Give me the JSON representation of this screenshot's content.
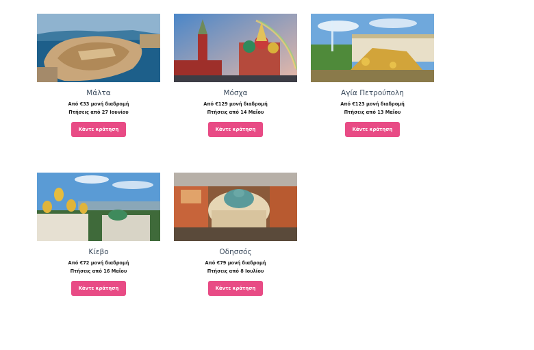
{
  "cards": [
    {
      "city": "Μάλτα",
      "price": "Από €33 μονή διαδρομή",
      "flights": "Πτήσεις από 27 Ιουνίου",
      "button": "Κάντε κράτηση",
      "image": "malta-aerial-photo"
    },
    {
      "city": "Μόσχα",
      "price": "Από €129 μονή διαδρομή",
      "flights": "Πτήσεις από 14 Μαΐου",
      "button": "Κάντε κράτηση",
      "image": "moscow-kremlin-photo"
    },
    {
      "city": "Αγία Πετρούπολη",
      "price": "Από €123 μονή διαδρομή",
      "flights": "Πτήσεις από 13 Μαΐου",
      "button": "Κάντε κράτηση",
      "image": "petersburg-peterhof-photo"
    },
    {
      "city": "Κίεβο",
      "price": "Από €72 μονή διαδρομή",
      "flights": "Πτήσεις από 16 Μαΐου",
      "button": "Κάντε κράτηση",
      "image": "kiev-lavra-photo"
    },
    {
      "city": "Οδησσός",
      "price": "Από €79 μονή διαδρομή",
      "flights": "Πτήσεις από 8 Ιουλίου",
      "button": "Κάντε κράτηση",
      "image": "odessa-opera-photo"
    }
  ]
}
